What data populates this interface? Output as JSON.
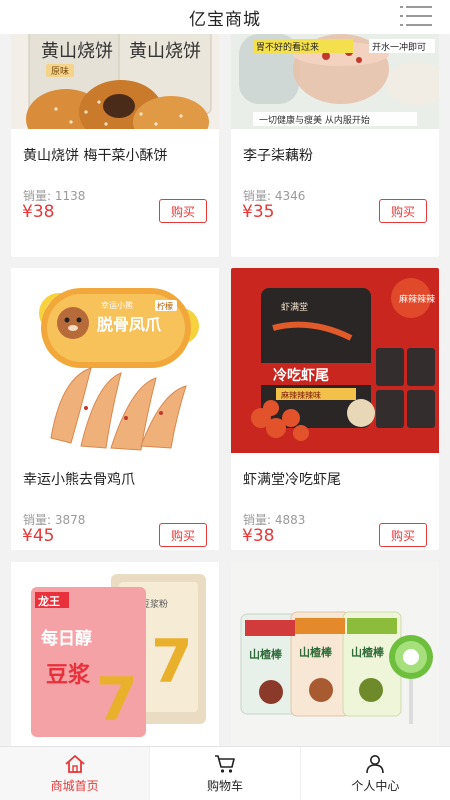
{
  "header": {
    "title": "亿宝商城",
    "menu_icon": "menu-list-icon"
  },
  "labels": {
    "sales_prefix": "销量:",
    "buy": "购买"
  },
  "products": [
    {
      "name": "黄山烧饼 梅干菜小酥饼",
      "sales": "销量: 1138",
      "price": "¥38",
      "buy": "购买",
      "image_text": [
        "黄山烧饼",
        "黄山烧饼",
        "原味"
      ]
    },
    {
      "name": "李子柒藕粉",
      "sales": "销量: 4346",
      "price": "¥35",
      "buy": "购买",
      "image_text": [
        "胃不好的看过来",
        "开水一冲即可",
        "一切健康与瘦美 从内服开始"
      ]
    },
    {
      "name": "幸运小熊去骨鸡爪",
      "sales": "销量: 3878",
      "price": "¥45",
      "buy": "购买",
      "image_text": [
        "幸运小熊",
        "柠檬",
        "脱骨凤爪"
      ]
    },
    {
      "name": "虾满堂冷吃虾尾",
      "sales": "销量: 4883",
      "price": "¥38",
      "buy": "购买",
      "image_text": [
        "虾满堂",
        "冷吃虾尾",
        "麻辣辣辣味",
        "麻辣辣辣"
      ]
    },
    {
      "name": "",
      "sales": "",
      "price": "",
      "buy": "",
      "image_text": [
        "龙王",
        "每日醇",
        "豆浆",
        "7",
        "原味豆浆粉"
      ]
    },
    {
      "name": "",
      "sales": "",
      "price": "",
      "buy": "",
      "image_text": [
        "山楂棒",
        "山楂棒",
        "山楂棒"
      ]
    }
  ],
  "tabbar": [
    {
      "label": "商城首页",
      "icon": "home-icon",
      "active": true
    },
    {
      "label": "购物车",
      "icon": "cart-icon",
      "active": false
    },
    {
      "label": "个人中心",
      "icon": "user-icon",
      "active": false
    }
  ],
  "colors": {
    "accent": "#e5393a",
    "background": "#f2f2f2",
    "card": "#ffffff"
  }
}
